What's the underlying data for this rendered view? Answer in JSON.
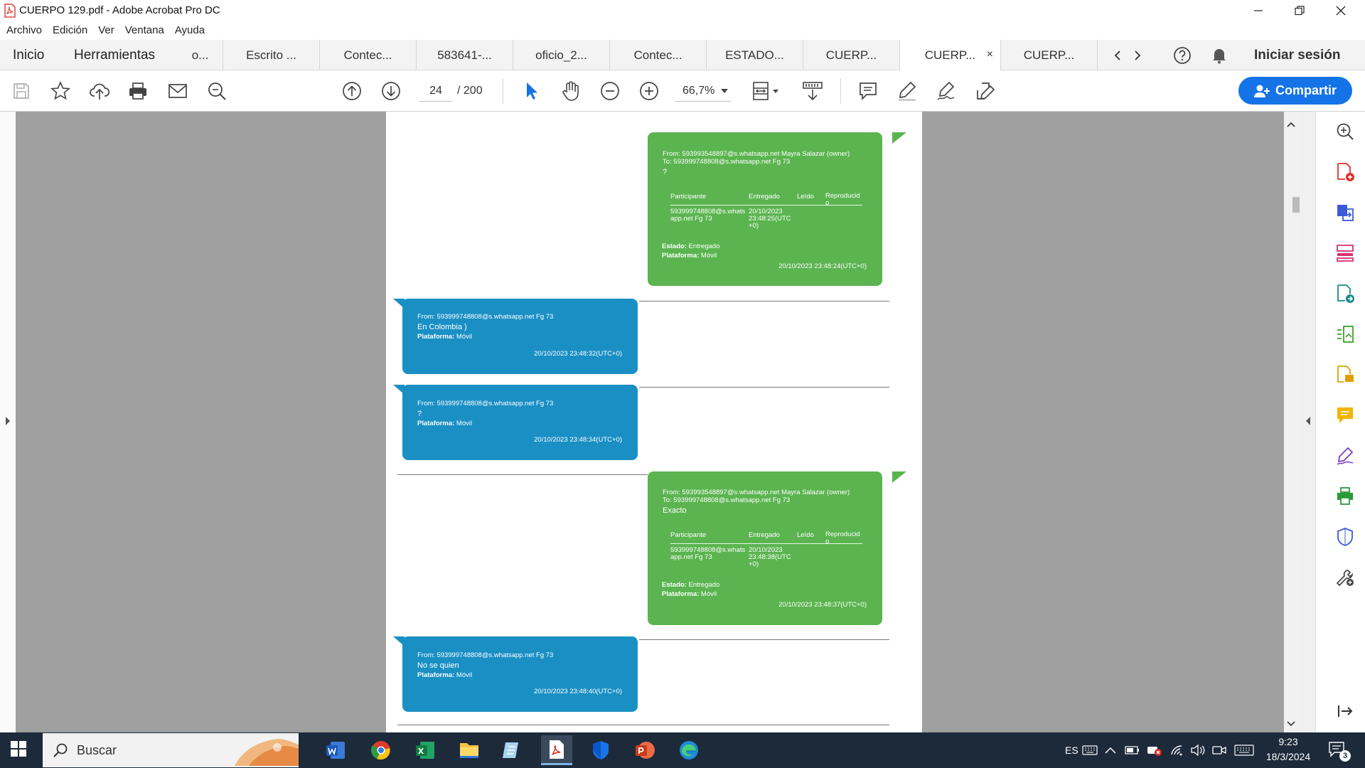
{
  "window": {
    "title": "CUERPO 129.pdf - Adobe Acrobat Pro DC"
  },
  "menu": [
    "Archivo",
    "Edición",
    "Ver",
    "Ventana",
    "Ayuda"
  ],
  "tabbar": {
    "home": "Inicio",
    "tools": "Herramientas",
    "tabs": [
      "o...",
      "Escrito ...",
      "Contec...",
      "583641-...",
      "oficio_2...",
      "Contec...",
      "ESTADO...",
      "CUERP...",
      "CUERP...",
      "CUERP..."
    ],
    "close_glyph": "×",
    "sign_in": "Iniciar sesión"
  },
  "toolbar": {
    "current_page": "24",
    "total_pages": "/  200",
    "zoom": "66,7%",
    "share_label": "Compartir"
  },
  "chat": [
    {
      "side": "right",
      "from": "From: 593993548897@s.whatsapp.net Mayra Salazar (owner)",
      "to": "To: 593999748808@s.whatsapp.net Fg 73",
      "message": "?",
      "table_headers": [
        "Participante",
        "Entregado",
        "Leído",
        "Reproducid o"
      ],
      "participant": "593999748808@s.whats app.net Fg 73",
      "delivered": "20/10/2023 23:48:25(UTC +0)",
      "status_label": "Estado:",
      "status": "Entregado",
      "platform_label": "Plataforma:",
      "platform": "Móvil",
      "timestamp": "20/10/2023 23:48:24(UTC+0)"
    },
    {
      "side": "left",
      "from": "From: 593999748808@s.whatsapp.net Fg 73",
      "message": "En Colombia )",
      "platform_label": "Plataforma:",
      "platform": "Móvil",
      "timestamp": "20/10/2023 23:48:32(UTC+0)"
    },
    {
      "side": "left",
      "from": "From: 593999748808@s.whatsapp.net Fg 73",
      "message": "?",
      "platform_label": "Plataforma:",
      "platform": "Móvil",
      "timestamp": "20/10/2023 23:48:34(UTC+0)"
    },
    {
      "side": "right",
      "from": "From: 593993548897@s.whatsapp.net Mayra Salazar (owner)",
      "to": "To: 593999748808@s.whatsapp.net Fg 73",
      "message": "Exacto",
      "table_headers": [
        "Participante",
        "Entregado",
        "Leído",
        "Reproducid o"
      ],
      "participant": "593999748808@s.whats app.net Fg 73",
      "delivered": "20/10/2023 23:48:38(UTC +0)",
      "status_label": "Estado:",
      "status": "Entregado",
      "platform_label": "Plataforma:",
      "platform": "Móvil",
      "timestamp": "20/10/2023 23:48:37(UTC+0)"
    },
    {
      "side": "left",
      "from": "From: 593999748808@s.whatsapp.net Fg 73",
      "message": "No se quien",
      "platform_label": "Plataforma:",
      "platform": "Móvil",
      "timestamp": "20/10/2023 23:48:40(UTC+0)"
    }
  ],
  "taskbar": {
    "search_placeholder": "Buscar",
    "language": "ES",
    "time": "9:23",
    "date": "18/3/2024",
    "notification_count": "3"
  },
  "colors": {
    "accent": "#1473e6",
    "bubble_green": "#5bb450",
    "bubble_blue": "#1a8fc4",
    "viewer_bg": "#a0a0a0",
    "taskbar": "#1c2a3a"
  }
}
